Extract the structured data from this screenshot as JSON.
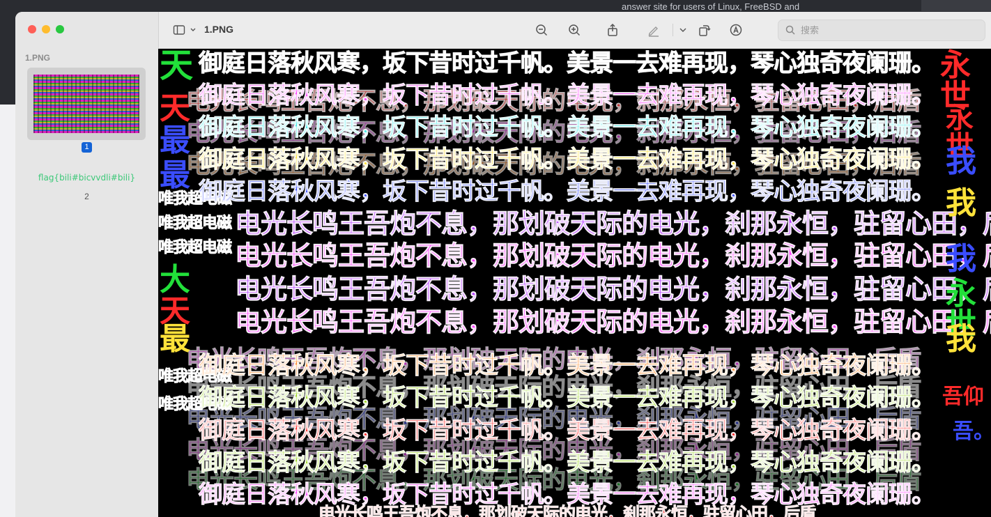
{
  "background": {
    "browser_snippet": "answer site for users of Linux, FreeBSD and"
  },
  "window": {
    "sidebar": {
      "doc_title": "1.PNG",
      "page1_label": "1",
      "flag_text": "flag{bili#bicvvdli#bili}",
      "page2_label": "2"
    },
    "toolbar": {
      "title": "1.PNG",
      "search_placeholder": "搜索",
      "icons": [
        "sidebar-toggle-icon",
        "chevron-down-icon",
        "zoom-out-icon",
        "zoom-in-icon",
        "share-icon",
        "markup-pen-icon",
        "chevron-down-icon",
        "rotate-icon",
        "annotate-icon",
        "search-icon"
      ]
    },
    "image": {
      "poem_line_a": "御庭日落秋风寒，坂下昔时过千帆。美景一去难再现，琴心独奇夜阑珊。",
      "poem_line_b": "电光长鸣王吾炮不息，那划破天际的电光，刹那永恒，驻留心田，后盾",
      "fragment_weo": "唯我超电磁",
      "fragment_right_a": "永世",
      "fragment_right_b": "我",
      "fragment_left_a": "天",
      "fragment_left_b": "最",
      "fragment_left_c": "大",
      "fragment_right_c": "吾仰",
      "fragment_right_d": "吾。",
      "colors": {
        "green": "#22e03a",
        "magenta": "#ff3dff",
        "cyan": "#3ee8e8",
        "yellow": "#ffe23a",
        "blue": "#3a4dff",
        "red": "#ff2a2a",
        "orange": "#ff8a2a",
        "white": "#ffffff",
        "purple": "#b43cff",
        "olive": "#9bd61f"
      }
    }
  }
}
